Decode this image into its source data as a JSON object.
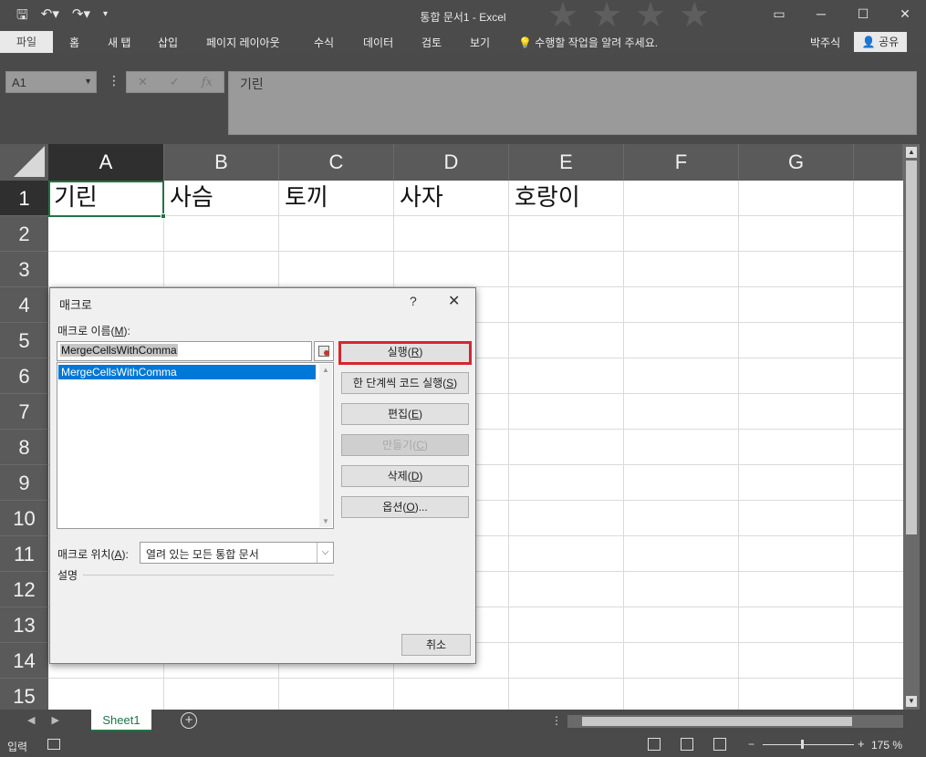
{
  "window": {
    "title": "통합 문서1 - Excel",
    "qat": [
      "save-icon",
      "undo-icon",
      "redo-icon",
      "customize-icon"
    ],
    "controls": [
      "ribbon-display-icon",
      "minimize-icon",
      "maximize-icon",
      "close-icon"
    ]
  },
  "ribbon": {
    "tabs": [
      "파일",
      "홈",
      "새 탭",
      "삽입",
      "페이지 레이아웃",
      "수식",
      "데이터",
      "검토",
      "보기"
    ],
    "tell_me": "수행할 작업을 알려 주세요.",
    "user": "박주식",
    "share": "공유"
  },
  "formula_bar": {
    "name_box": "A1",
    "content": "기린"
  },
  "sheet": {
    "columns": [
      "A",
      "B",
      "C",
      "D",
      "E",
      "F",
      "G"
    ],
    "rows": [
      "1",
      "2",
      "3",
      "4",
      "5",
      "6",
      "7",
      "8",
      "9",
      "10",
      "11",
      "12",
      "13",
      "14",
      "15"
    ],
    "row1": [
      "기린",
      "사슴",
      "토끼",
      "사자",
      "호랑이"
    ],
    "tab": "Sheet1",
    "add_sheet": "+"
  },
  "status": {
    "mode": "입력",
    "zoom": "175 %"
  },
  "dialog": {
    "title": "매크로",
    "help": "?",
    "close": "✕",
    "name_label": "매크로 이름(M):",
    "name_label_pre": "매크로 이름(",
    "name_label_key": "M",
    "name_label_post": "):",
    "name_value": "MergeCellsWithComma",
    "list": [
      "MergeCellsWithComma"
    ],
    "location_label_pre": "매크로 위치(",
    "location_label_key": "A",
    "location_label_post": "):",
    "location_value": "열려 있는 모든 통합 문서",
    "description_label": "설명",
    "buttons": {
      "run": {
        "pre": "실행(",
        "key": "R",
        "post": ")"
      },
      "step": {
        "pre": "한 단계씩 코드 실행(",
        "key": "S",
        "post": ")"
      },
      "edit": {
        "pre": "편집(",
        "key": "E",
        "post": ")"
      },
      "create": {
        "pre": "만들기(",
        "key": "C",
        "post": ")"
      },
      "delete": {
        "pre": "삭제(",
        "key": "D",
        "post": ")"
      },
      "options": {
        "pre": "옵션(",
        "key": "O",
        "post": ")..."
      },
      "cancel": "취소"
    }
  }
}
